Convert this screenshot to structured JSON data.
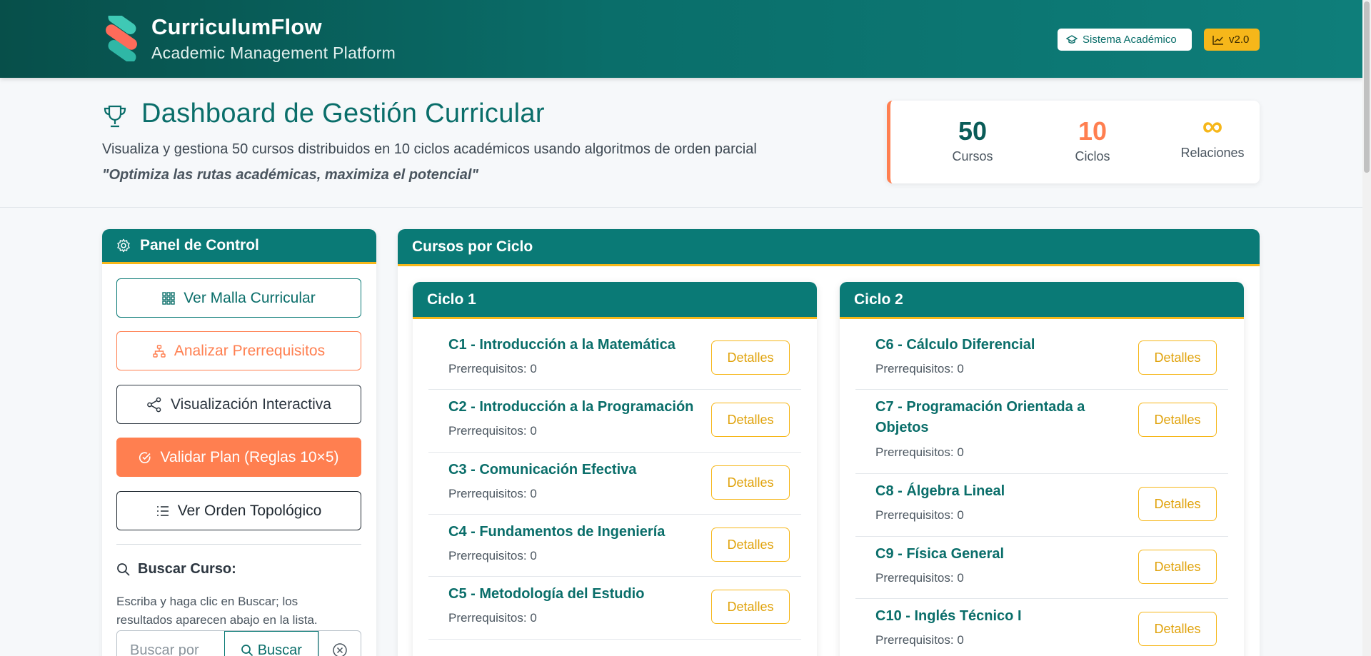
{
  "header": {
    "brand_title": "CurriculumFlow",
    "brand_subtitle": "Academic Management Platform",
    "badge_system": "Sistema Académico",
    "badge_version": "v2.0"
  },
  "intro": {
    "title": "Dashboard de Gestión Curricular",
    "description": "Visualiza y gestiona 50 cursos distribuidos en 10 ciclos académicos usando algoritmos de orden parcial",
    "quote": "\"Optimiza las rutas académicas, maximiza el potencial\""
  },
  "stats": [
    {
      "value": "50",
      "label": "Cursos"
    },
    {
      "value": "10",
      "label": "Ciclos"
    },
    {
      "value": "∞",
      "label": "Relaciones"
    }
  ],
  "panel": {
    "title": "Panel de Control",
    "buttons": [
      {
        "label": "Ver Malla Curricular",
        "icon": "grid-icon"
      },
      {
        "label": "Analizar Prerrequisitos",
        "icon": "hierarchy-icon"
      },
      {
        "label": "Visualización Interactiva",
        "icon": "share-nodes-icon"
      },
      {
        "label": "Validar Plan (Reglas 10×5)",
        "icon": "check-circle-icon"
      },
      {
        "label": "Ver Orden Topológico",
        "icon": "list-icon"
      }
    ],
    "search_label": "Buscar Curso:",
    "search_help": "Escriba y haga clic en Buscar; los resultados aparecen abajo en la lista.",
    "search_placeholder": "Buscar por",
    "search_button": "Buscar"
  },
  "courses": {
    "title": "Cursos por Ciclo",
    "details_label": "Detalles",
    "cycles": [
      {
        "name": "Ciclo 1",
        "items": [
          {
            "name": "C1 - Introducción a la Matemática",
            "prereq": "Prerrequisitos: 0"
          },
          {
            "name": "C2 - Introducción a la Programación",
            "prereq": "Prerrequisitos: 0"
          },
          {
            "name": "C3 - Comunicación Efectiva",
            "prereq": "Prerrequisitos: 0"
          },
          {
            "name": "C4 - Fundamentos de Ingeniería",
            "prereq": "Prerrequisitos: 0"
          },
          {
            "name": "C5 - Metodología del Estudio",
            "prereq": "Prerrequisitos: 0"
          }
        ]
      },
      {
        "name": "Ciclo 2",
        "items": [
          {
            "name": "C6 - Cálculo Diferencial",
            "prereq": "Prerrequisitos: 0"
          },
          {
            "name": "C7 - Programación Orientada a Objetos",
            "prereq": "Prerrequisitos: 0"
          },
          {
            "name": "C8 - Álgebra Lineal",
            "prereq": "Prerrequisitos: 0"
          },
          {
            "name": "C9 - Física General",
            "prereq": "Prerrequisitos: 0"
          },
          {
            "name": "C10 - Inglés Técnico I",
            "prereq": "Prerrequisitos: 0"
          }
        ]
      }
    ]
  },
  "colors": {
    "primary": "#0a7a76",
    "accent": "#ff7f50",
    "warning": "#f6b71a"
  }
}
